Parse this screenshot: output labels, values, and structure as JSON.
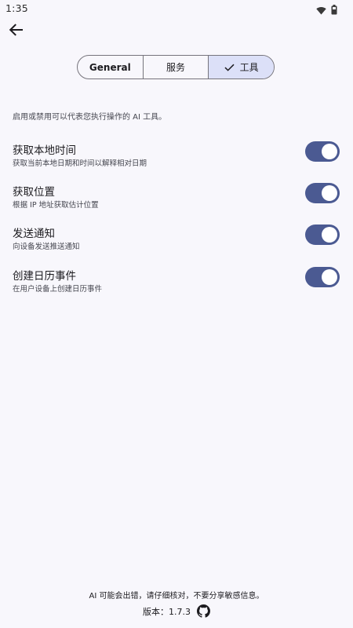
{
  "status_bar": {
    "time": "1:35",
    "icons": [
      "wifi-icon",
      "battery-icon"
    ]
  },
  "header": {
    "back_icon": "arrow-back-icon"
  },
  "segments": [
    {
      "label": "General",
      "selected": false
    },
    {
      "label": "服务",
      "selected": false
    },
    {
      "label": "工具",
      "selected": true
    }
  ],
  "description": "启用或禁用可以代表您执行操作的 AI 工具。",
  "tools": [
    {
      "title": "获取本地时间",
      "subtitle": "获取当前本地日期和时间以解释相对日期",
      "enabled": true
    },
    {
      "title": "获取位置",
      "subtitle": "根据 IP 地址获取估计位置",
      "enabled": true
    },
    {
      "title": "发送通知",
      "subtitle": "向设备发送推送通知",
      "enabled": true
    },
    {
      "title": "创建日历事件",
      "subtitle": "在用户设备上创建日历事件",
      "enabled": true
    }
  ],
  "footer": {
    "disclaimer": "AI 可能会出错，请仔细核对，不要分享敏感信息。",
    "version": "版本：1.7.3",
    "github_icon": "github-icon"
  },
  "colors": {
    "background": "#F8F7FC",
    "accent": "#4B5A92",
    "segment_selected": "#DCE0F8"
  }
}
